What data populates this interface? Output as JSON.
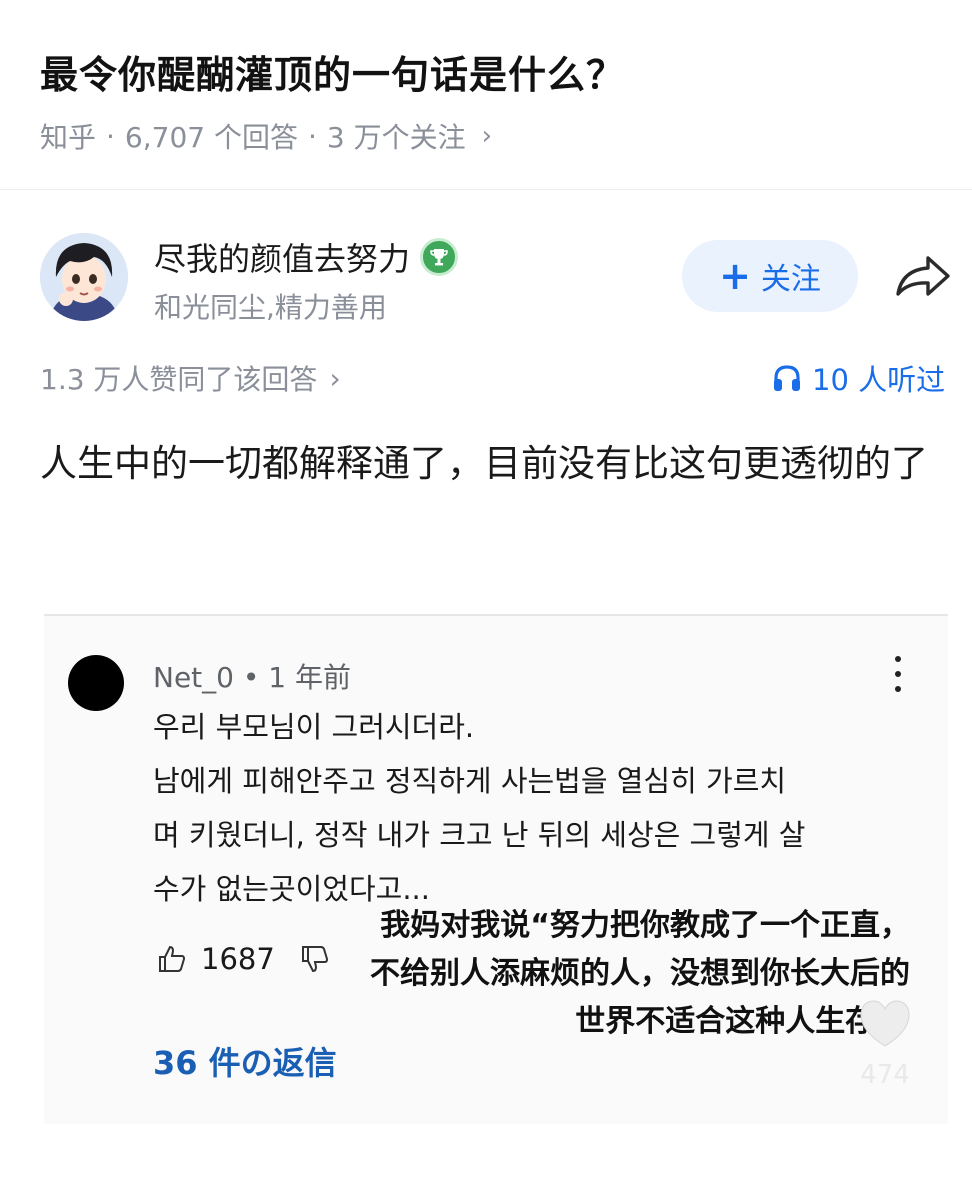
{
  "question": {
    "title": "最令你醍醐灌顶的一句话是什么？",
    "source": "知乎",
    "answers": "6,707 个回答",
    "followers": "3 万个关注",
    "dot": "·"
  },
  "author": {
    "name": "尽我的颜值去努力",
    "bio": "和光同尘,精力善用",
    "follow_label": "关注",
    "follow_plus": "+"
  },
  "stats": {
    "upvotes": "1.3 万人赞同了该回答",
    "listened": "10 人听过"
  },
  "answer": {
    "text": "人生中的一切都解释通了，目前没有比这句更透彻的了"
  },
  "comment": {
    "meta": "Net_0 • 1 年前",
    "lines": [
      "우리 부모님이 그러시더라.",
      "남에게 피해안주고 정직하게 사는법을 열심히 가르치",
      "며 키웠더니, 정작 내가 크고 난 뒤의 세상은 그렇게 살",
      "수가 없는곳이었다고..."
    ],
    "likes": "1687",
    "replies": "36 件の返信"
  },
  "overlay": {
    "lines": [
      "我妈对我说“努力把你教成了一个正直，",
      "不给别人添麻烦的人，没想到你长大后的",
      "世界不适合这种人生存。”"
    ]
  },
  "like_float": {
    "count": "474"
  },
  "colors": {
    "accent": "#1a6de8",
    "follow_bg": "#eaf2fe",
    "meta_gray": "#8a8f99",
    "reply_blue": "#1a5fb4"
  }
}
